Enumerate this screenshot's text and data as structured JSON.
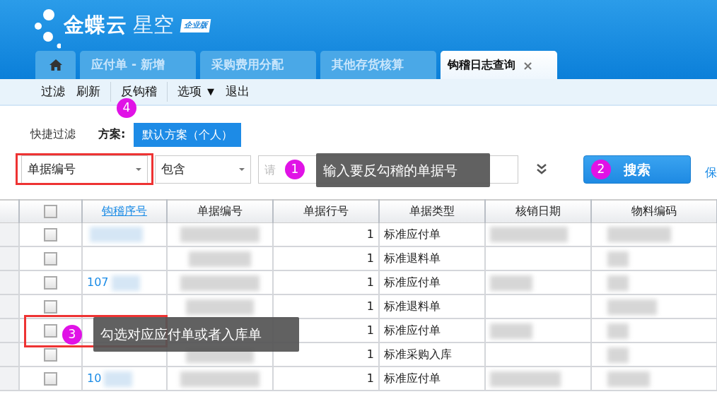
{
  "header": {
    "brand": "金蝶云",
    "product": "星空",
    "edition": "企业版"
  },
  "tabs": [
    {
      "kind": "home",
      "selected": false
    },
    {
      "kind": "text",
      "label": "应付单 - 新增",
      "selected": false
    },
    {
      "kind": "text",
      "label": "采购费用分配",
      "selected": false
    },
    {
      "kind": "text",
      "label": "其他存货核算",
      "selected": false
    },
    {
      "kind": "text",
      "label": "钩稽日志查询",
      "selected": true,
      "close": "×"
    }
  ],
  "toolbar": [
    {
      "kind": "item",
      "label": "过滤"
    },
    {
      "kind": "item",
      "label": "刷新"
    },
    {
      "kind": "separator"
    },
    {
      "kind": "item",
      "label": "反钩稽"
    },
    {
      "kind": "separator"
    },
    {
      "kind": "menu",
      "label": "选项",
      "caret": "▼"
    },
    {
      "kind": "item",
      "label": "退出"
    }
  ],
  "quick_filter": {
    "label": "快捷过滤",
    "scheme_label": "方案:",
    "scheme": "默认方案（个人）"
  },
  "filter": {
    "field": "单据编号",
    "operator": "包含",
    "placeholder": "请",
    "search": "搜索",
    "save_link": "保"
  },
  "table": {
    "columns": [
      {
        "kind": "checkbox",
        "checked": false
      },
      {
        "kind": "link",
        "label": "钩稽序号"
      },
      {
        "kind": "text",
        "label": "单据编号"
      },
      {
        "kind": "text",
        "label": "单据行号"
      },
      {
        "kind": "text",
        "label": "单据类型"
      },
      {
        "kind": "text",
        "label": "核销日期"
      },
      {
        "kind": "text",
        "label": "物料编码"
      }
    ],
    "rows": [
      {
        "checked": false,
        "check_no": "",
        "line_no": "1",
        "bill_type": "标准应付单"
      },
      {
        "checked": false,
        "check_no": "",
        "line_no": "1",
        "bill_type": "标准退料单"
      },
      {
        "checked": false,
        "check_no": "107",
        "line_no": "1",
        "bill_type": "标准应付单"
      },
      {
        "checked": false,
        "check_no": "",
        "line_no": "1",
        "bill_type": "标准退料单"
      },
      {
        "checked": false,
        "check_no": "",
        "line_no": "1",
        "bill_type": "标准应付单"
      },
      {
        "checked": false,
        "check_no": "",
        "line_no": "1",
        "bill_type": "标准采购入库"
      },
      {
        "checked": false,
        "check_no": "10",
        "line_no": "1",
        "bill_type": "标准应付单"
      }
    ]
  },
  "annotations": [
    {
      "kind": "frame"
    },
    {
      "kind": "bubble",
      "number": "4"
    },
    {
      "kind": "callout",
      "number": "1",
      "text": "输入要反勾稽的单据号"
    },
    {
      "kind": "bubble",
      "number": "2"
    },
    {
      "kind": "frame"
    },
    {
      "kind": "callout",
      "number": "3",
      "text": "勾选对应应付单或者入库单"
    }
  ]
}
